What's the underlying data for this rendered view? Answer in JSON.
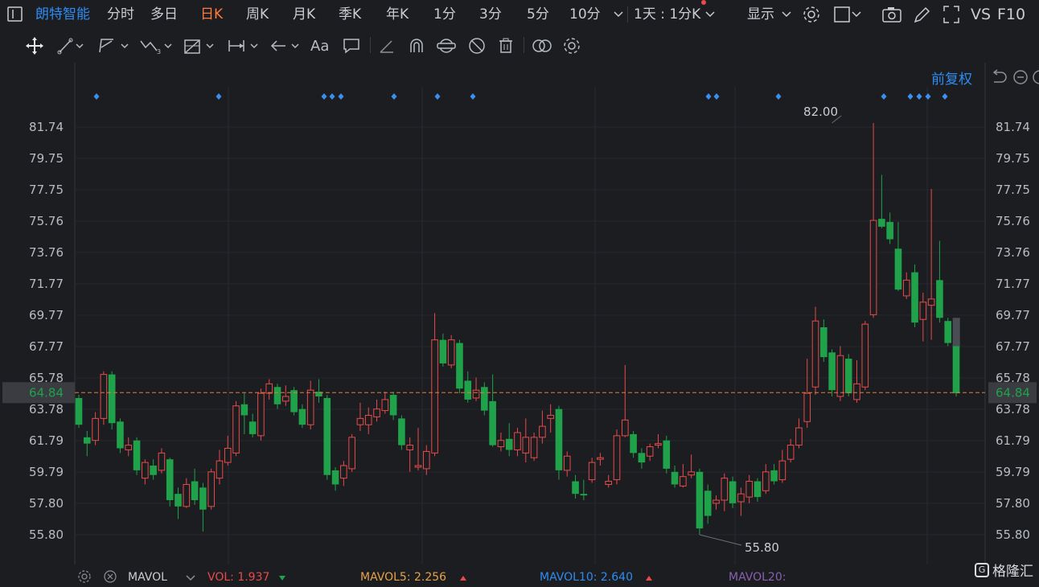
{
  "header": {
    "stock_name": "朗特智能",
    "periods": [
      "分时",
      "多日",
      "日K",
      "周K",
      "月K",
      "季K",
      "年K",
      "1分",
      "3分",
      "5分",
      "10分"
    ],
    "active_period": "日K",
    "custom_period": "1天 : 1分K",
    "display_label": "显示",
    "vs_label": "VS",
    "f10_label": "F10"
  },
  "toolbar": {
    "font_tool_label": "Aa"
  },
  "chart": {
    "adjust_label": "前复权",
    "price_ticks": [
      "81.74",
      "79.75",
      "77.75",
      "75.76",
      "73.76",
      "71.77",
      "69.77",
      "67.77",
      "65.78",
      "63.78",
      "61.79",
      "59.79",
      "57.80",
      "55.80"
    ],
    "current_price": "64.84",
    "max_label": "82.00",
    "min_label": "55.80"
  },
  "volume_legend": {
    "mavol": "MAVOL",
    "vol": "VOL: 1.937",
    "mavol5": "MAVOL5: 2.256",
    "mavol10": "MAVOL10: 2.640",
    "mavol20": "MAVOL20:"
  },
  "watermark": "格隆汇",
  "colors": {
    "up": "#e84a4a",
    "down": "#1fa24a",
    "accent": "#2f8bf0",
    "active": "#ff7a3d",
    "price_line": "#e87a3d"
  },
  "chart_data": {
    "type": "candlestick",
    "ylim": [
      55.0,
      82.5
    ],
    "candles": [
      [
        64.5,
        62.8,
        64.7,
        62.6
      ],
      [
        62.0,
        61.6,
        62.4,
        60.8
      ],
      [
        61.8,
        63.2,
        63.6,
        61.5
      ],
      [
        63.2,
        66.0,
        66.2,
        62.8
      ],
      [
        66.0,
        62.9,
        66.2,
        62.5
      ],
      [
        63.0,
        61.3,
        63.2,
        61.0
      ],
      [
        61.2,
        61.5,
        62.0,
        60.8
      ],
      [
        61.8,
        59.9,
        62.0,
        59.6
      ],
      [
        59.4,
        60.4,
        60.6,
        59.0
      ],
      [
        60.2,
        59.6,
        60.6,
        59.3
      ],
      [
        59.9,
        61.0,
        61.3,
        59.7
      ],
      [
        60.6,
        58.0,
        60.7,
        57.6
      ],
      [
        58.4,
        57.6,
        58.8,
        56.8
      ],
      [
        57.6,
        59.0,
        59.4,
        57.5
      ],
      [
        59.2,
        58.0,
        60.0,
        57.7
      ],
      [
        58.8,
        57.4,
        59.1,
        56.0
      ],
      [
        57.6,
        59.8,
        60.0,
        57.4
      ],
      [
        59.4,
        60.5,
        61.2,
        59.0
      ],
      [
        60.4,
        61.3,
        62.1,
        60.2
      ],
      [
        61.0,
        64.0,
        64.3,
        60.8
      ],
      [
        64.1,
        63.4,
        64.8,
        62.2
      ],
      [
        63.0,
        62.2,
        63.5,
        62.0
      ],
      [
        62.1,
        64.8,
        65.1,
        61.8
      ],
      [
        64.8,
        65.4,
        65.7,
        64.4
      ],
      [
        65.2,
        64.1,
        65.4,
        63.8
      ],
      [
        64.3,
        64.6,
        65.3,
        64.0
      ],
      [
        65.0,
        63.6,
        65.2,
        63.4
      ],
      [
        63.8,
        62.8,
        64.1,
        62.6
      ],
      [
        62.8,
        65.0,
        65.6,
        62.5
      ],
      [
        64.9,
        64.6,
        65.7,
        64.2
      ],
      [
        64.5,
        59.6,
        64.7,
        59.3
      ],
      [
        59.9,
        59.0,
        60.1,
        58.6
      ],
      [
        59.4,
        60.2,
        60.5,
        58.9
      ],
      [
        60.0,
        62.0,
        62.2,
        59.8
      ],
      [
        62.8,
        63.2,
        64.2,
        62.4
      ],
      [
        62.8,
        63.4,
        63.9,
        62.2
      ],
      [
        63.3,
        63.8,
        64.4,
        63.0
      ],
      [
        63.7,
        64.4,
        64.9,
        63.5
      ],
      [
        64.7,
        63.4,
        64.9,
        63.1
      ],
      [
        63.2,
        61.5,
        63.4,
        61.2
      ],
      [
        61.2,
        61.5,
        62.0,
        59.8
      ],
      [
        60.1,
        60.2,
        62.6,
        59.9
      ],
      [
        60.0,
        61.1,
        61.5,
        59.6
      ],
      [
        61.0,
        68.2,
        69.9,
        60.8
      ],
      [
        68.2,
        66.7,
        68.6,
        66.5
      ],
      [
        66.6,
        68.2,
        68.5,
        66.4
      ],
      [
        68.0,
        65.1,
        68.2,
        64.8
      ],
      [
        65.6,
        64.4,
        66.2,
        64.2
      ],
      [
        64.5,
        65.0,
        65.8,
        64.3
      ],
      [
        65.2,
        63.7,
        65.5,
        63.4
      ],
      [
        64.3,
        61.5,
        66.0,
        61.4
      ],
      [
        61.4,
        61.8,
        62.3,
        61.1
      ],
      [
        61.9,
        61.2,
        62.9,
        60.8
      ],
      [
        61.2,
        62.3,
        62.6,
        60.8
      ],
      [
        61.0,
        62.0,
        63.2,
        60.4
      ],
      [
        60.7,
        62.0,
        62.3,
        60.5
      ],
      [
        62.0,
        62.7,
        63.7,
        61.6
      ],
      [
        63.2,
        63.4,
        64.1,
        62.3
      ],
      [
        63.8,
        59.9,
        64.0,
        59.3
      ],
      [
        59.9,
        60.8,
        61.1,
        59.5
      ],
      [
        59.2,
        58.4,
        59.6,
        58.1
      ],
      [
        58.4,
        58.3,
        59.3,
        58.0
      ],
      [
        59.3,
        60.4,
        60.7,
        59.1
      ],
      [
        60.6,
        60.7,
        61.0,
        60.2
      ],
      [
        59.0,
        59.2,
        59.6,
        58.8
      ],
      [
        59.3,
        62.1,
        62.5,
        59.0
      ],
      [
        62.1,
        63.1,
        66.6,
        62.0
      ],
      [
        62.2,
        61.0,
        62.4,
        60.7
      ],
      [
        61.0,
        60.4,
        61.3,
        60.0
      ],
      [
        60.8,
        61.4,
        61.6,
        60.5
      ],
      [
        61.5,
        61.6,
        62.2,
        61.3
      ],
      [
        61.8,
        60.0,
        62.1,
        59.7
      ],
      [
        59.8,
        59.0,
        60.2,
        58.8
      ],
      [
        58.9,
        59.5,
        60.3,
        58.8
      ],
      [
        59.6,
        59.8,
        60.9,
        59.4
      ],
      [
        59.8,
        56.2,
        60.0,
        55.8
      ],
      [
        58.6,
        57.0,
        59.0,
        56.5
      ],
      [
        57.8,
        58.0,
        58.3,
        57.4
      ],
      [
        58.0,
        59.4,
        59.7,
        57.3
      ],
      [
        59.2,
        57.8,
        59.5,
        57.5
      ],
      [
        57.9,
        58.4,
        58.8,
        57.0
      ],
      [
        58.2,
        59.2,
        59.6,
        57.8
      ],
      [
        59.2,
        58.2,
        59.4,
        57.9
      ],
      [
        58.6,
        59.8,
        60.3,
        58.4
      ],
      [
        59.9,
        59.2,
        60.3,
        59.0
      ],
      [
        59.3,
        60.5,
        61.2,
        59.1
      ],
      [
        60.6,
        61.5,
        61.9,
        60.4
      ],
      [
        61.5,
        62.6,
        63.2,
        61.3
      ],
      [
        63.0,
        64.8,
        67.0,
        62.6
      ],
      [
        65.2,
        69.4,
        70.3,
        64.7
      ],
      [
        69.0,
        67.1,
        69.5,
        66.8
      ],
      [
        67.4,
        65.0,
        67.6,
        64.6
      ],
      [
        64.6,
        67.2,
        67.8,
        64.3
      ],
      [
        67.0,
        64.8,
        67.3,
        64.6
      ],
      [
        64.4,
        65.4,
        66.9,
        64.2
      ],
      [
        65.2,
        69.2,
        69.4,
        65.0
      ],
      [
        69.8,
        75.8,
        82.0,
        69.6
      ],
      [
        75.9,
        75.4,
        78.7,
        75.3
      ],
      [
        75.7,
        74.6,
        76.3,
        74.3
      ],
      [
        74.0,
        71.4,
        75.7,
        71.3
      ],
      [
        71.0,
        72.0,
        72.5,
        70.8
      ],
      [
        72.5,
        69.3,
        73.0,
        69.0
      ],
      [
        69.5,
        70.6,
        71.2,
        68.1
      ],
      [
        70.4,
        70.8,
        77.8,
        68.2
      ],
      [
        72.0,
        69.6,
        74.5,
        69.3
      ],
      [
        69.4,
        68.0,
        69.6,
        67.8
      ],
      [
        67.9,
        64.8,
        68.2,
        64.6
      ]
    ]
  }
}
